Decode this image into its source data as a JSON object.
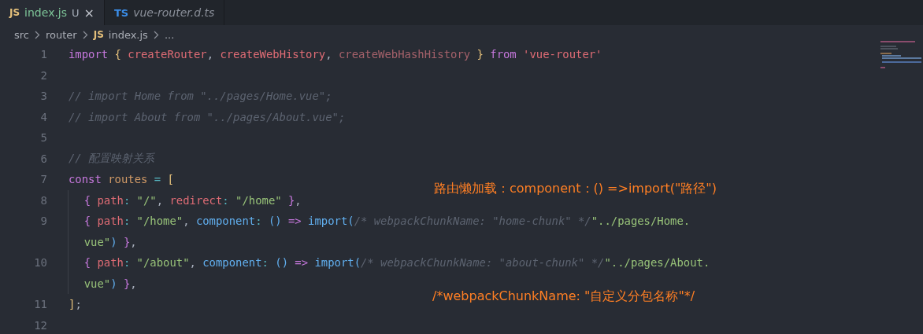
{
  "tabs": [
    {
      "badge": "JS",
      "label": "index.js",
      "status": "U",
      "close": "×",
      "selected": true
    },
    {
      "badge": "TS",
      "label": "vue-router.d.ts",
      "selected": false
    }
  ],
  "breadcrumb": [
    {
      "text": "src"
    },
    {
      "text": "router"
    },
    {
      "badge": "JS",
      "text": "index.js"
    },
    {
      "text": "..."
    }
  ],
  "code_lines": [
    {
      "number": "1",
      "tokens": [
        {
          "kind": "kw",
          "t": "import "
        },
        {
          "kind": "brace",
          "t": "{ "
        },
        {
          "kind": "var",
          "t": "createRouter"
        },
        {
          "kind": "plain",
          "t": ", "
        },
        {
          "kind": "var",
          "t": "createWebHistory"
        },
        {
          "kind": "plain",
          "t": ", "
        },
        {
          "kind": "unused",
          "t": "createWebHashHistory"
        },
        {
          "kind": "brace",
          "t": " } "
        },
        {
          "kind": "kw",
          "t": "from "
        },
        {
          "kind": "var",
          "t": "'vue-router'"
        }
      ]
    },
    {
      "number": "2"
    },
    {
      "number": "3",
      "tokens": [
        {
          "kind": "comment",
          "t": "// import Home from \"../pages/Home.vue\";"
        }
      ]
    },
    {
      "number": "4",
      "tokens": [
        {
          "kind": "comment",
          "t": "// import About from \"../pages/About.vue\";"
        }
      ]
    },
    {
      "number": "5"
    },
    {
      "number": "6",
      "tokens": [
        {
          "kind": "comment",
          "t": "// 配置映射关系"
        }
      ]
    },
    {
      "number": "7",
      "tokens": [
        {
          "kind": "kw",
          "t": "const "
        },
        {
          "kind": "name",
          "t": "routes"
        },
        {
          "kind": "op",
          "t": " = "
        },
        {
          "kind": "brace",
          "t": "["
        }
      ]
    },
    {
      "number": "8",
      "indented": true,
      "tokens": [
        {
          "kind": "kw",
          "t": "{ "
        },
        {
          "kind": "var",
          "t": "path"
        },
        {
          "kind": "op",
          "t": ": "
        },
        {
          "kind": "str",
          "t": "\"/\""
        },
        {
          "kind": "plain",
          "t": ", "
        },
        {
          "kind": "var",
          "t": "redirect"
        },
        {
          "kind": "op",
          "t": ": "
        },
        {
          "kind": "str",
          "t": "\"/home\""
        },
        {
          "kind": "kw",
          "t": " }"
        },
        {
          "kind": "plain",
          "t": ","
        }
      ]
    },
    {
      "number": "9",
      "indented": true,
      "tokens": [
        {
          "kind": "kw",
          "t": "{ "
        },
        {
          "kind": "var",
          "t": "path"
        },
        {
          "kind": "op",
          "t": ": "
        },
        {
          "kind": "str",
          "t": "\"/home\""
        },
        {
          "kind": "plain",
          "t": ", "
        },
        {
          "kind": "fn",
          "t": "component"
        },
        {
          "kind": "op",
          "t": ": "
        },
        {
          "kind": "fn",
          "t": "() "
        },
        {
          "kind": "kw",
          "t": "=> "
        },
        {
          "kind": "fn",
          "t": "import("
        },
        {
          "kind": "comment",
          "t": "/* webpackChunkName: \"home-chunk\" */"
        },
        {
          "kind": "str",
          "t": "\"../pages/Home."
        }
      ]
    },
    {
      "indented": true,
      "tokens": [
        {
          "kind": "str",
          "t": "vue\""
        },
        {
          "kind": "fn",
          "t": ")"
        },
        {
          "kind": "kw",
          "t": " }"
        },
        {
          "kind": "plain",
          "t": ","
        }
      ]
    },
    {
      "number": "10",
      "indented": true,
      "tokens": [
        {
          "kind": "kw",
          "t": "{ "
        },
        {
          "kind": "var",
          "t": "path"
        },
        {
          "kind": "op",
          "t": ": "
        },
        {
          "kind": "str",
          "t": "\"/about\""
        },
        {
          "kind": "plain",
          "t": ", "
        },
        {
          "kind": "fn",
          "t": "component"
        },
        {
          "kind": "op",
          "t": ": "
        },
        {
          "kind": "fn",
          "t": "() "
        },
        {
          "kind": "kw",
          "t": "=> "
        },
        {
          "kind": "fn",
          "t": "import("
        },
        {
          "kind": "comment",
          "t": "/* webpackChunkName: \"about-chunk\" */"
        },
        {
          "kind": "str",
          "t": "\"../pages/About."
        }
      ]
    },
    {
      "indented": true,
      "tokens": [
        {
          "kind": "str",
          "t": "vue\""
        },
        {
          "kind": "fn",
          "t": ")"
        },
        {
          "kind": "kw",
          "t": " }"
        },
        {
          "kind": "plain",
          "t": ","
        }
      ]
    },
    {
      "number": "11",
      "tokens": [
        {
          "kind": "brace",
          "t": "]"
        },
        {
          "kind": "plain",
          "t": ";"
        }
      ]
    },
    {
      "number": "12"
    }
  ],
  "annotations": [
    {
      "text": "路由懒加载：component：() =>import(\"路径\")"
    },
    {
      "text": "/*webpackChunkName: \"自定义分包名称\"*/"
    }
  ]
}
